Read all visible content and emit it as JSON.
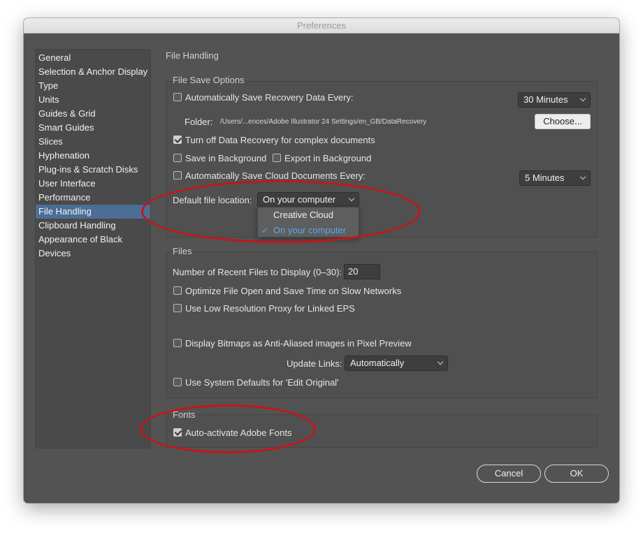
{
  "window": {
    "title": "Preferences"
  },
  "sidebar": {
    "items": [
      {
        "label": "General"
      },
      {
        "label": "Selection & Anchor Display"
      },
      {
        "label": "Type"
      },
      {
        "label": "Units"
      },
      {
        "label": "Guides & Grid"
      },
      {
        "label": "Smart Guides"
      },
      {
        "label": "Slices"
      },
      {
        "label": "Hyphenation"
      },
      {
        "label": "Plug-ins & Scratch Disks"
      },
      {
        "label": "User Interface"
      },
      {
        "label": "Performance"
      },
      {
        "label": "File Handling"
      },
      {
        "label": "Clipboard Handling"
      },
      {
        "label": "Appearance of Black"
      },
      {
        "label": "Devices"
      }
    ],
    "selected": "File Handling"
  },
  "panel": {
    "title": "File Handling"
  },
  "file_save": {
    "title": "File Save Options",
    "auto_save_label": "Automatically Save Recovery Data Every:",
    "auto_save_checked": false,
    "auto_save_interval": "30 Minutes",
    "folder_label": "Folder:",
    "folder_path": "/Users/...ences/Adobe Illustrator 24 Settings/en_GB/DataRecovery",
    "choose_label": "Choose...",
    "turn_off_label": "Turn off Data Recovery for complex documents",
    "turn_off_checked": true,
    "save_bg_label": "Save in Background",
    "save_bg_checked": false,
    "export_bg_label": "Export in Background",
    "export_bg_checked": false,
    "cloud_label": "Automatically Save Cloud Documents Every:",
    "cloud_checked": false,
    "cloud_interval": "5 Minutes",
    "default_loc_label": "Default file location:",
    "default_loc_value": "On your computer",
    "default_loc_options": [
      "Creative Cloud",
      "On your computer"
    ],
    "default_loc_check": "✓"
  },
  "files": {
    "title": "Files",
    "recent_label": "Number of Recent Files to Display (0–30):",
    "recent_value": "20",
    "optimize_label": "Optimize File Open and Save Time on Slow Networks",
    "optimize_checked": false,
    "low_res_label": "Use Low Resolution Proxy for Linked EPS",
    "low_res_checked": false,
    "bitmaps_label": "Display Bitmaps as Anti-Aliased images in Pixel Preview",
    "bitmaps_checked": false,
    "update_links_label": "Update Links:",
    "update_links_value": "Automatically",
    "system_defaults_label": "Use System Defaults for 'Edit Original'",
    "system_defaults_checked": false
  },
  "fonts": {
    "title": "Fonts",
    "auto_activate_label": "Auto-activate Adobe Fonts",
    "auto_activate_checked": true
  },
  "footer": {
    "cancel_label": "Cancel",
    "ok_label": "OK"
  },
  "colors": {
    "panel_bg": "#535353",
    "selected_item": "#4b6e95",
    "annotation": "#c8141a",
    "dropdown_selected_text": "#5aa6ee"
  }
}
